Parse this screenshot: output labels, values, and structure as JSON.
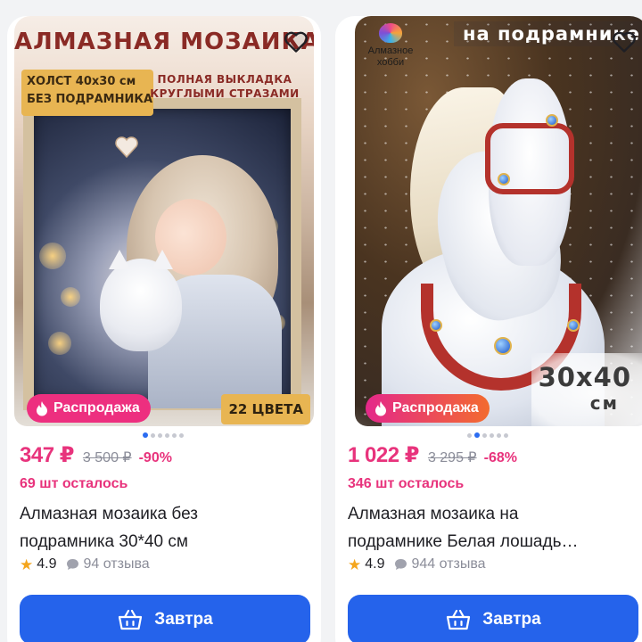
{
  "products": [
    {
      "photo": {
        "title": "АЛМАЗНАЯ МОЗАИКА",
        "badge_line1": "ХОЛСТ 40х30 см",
        "badge_line2": "БЕЗ ПОДРАМНИКА",
        "subtitle_line1": "ПОЛНАЯ ВЫКЛАДКА",
        "subtitle_line2": "КРУГЛЫМИ СТРАЗАМИ",
        "colors_tag": "22 ЦВЕТА"
      },
      "sale_label": "Распродажа",
      "price": "347 ₽",
      "old_price": "3 500 ₽",
      "discount": "-90%",
      "stock": "69 шт осталось",
      "name_line1": "Алмазная мозаика без",
      "name_line2": "подрамника 30*40 см",
      "rating": "4.9",
      "reviews": "94 отзыва",
      "button_label": "Завтра",
      "slides": {
        "total": 6,
        "active": 1
      }
    },
    {
      "photo": {
        "banner": "на подрамнике",
        "logo_line1": "Алмазное",
        "logo_line2": "хобби",
        "size_value": "30x40",
        "size_unit": "см"
      },
      "sale_label": "Распродажа",
      "price": "1 022 ₽",
      "old_price": "3 295 ₽",
      "discount": "-68%",
      "stock": "346 шт осталось",
      "name_line1": "Алмазная мозаика на",
      "name_line2": "подрамнике Белая лошадь…",
      "rating": "4.9",
      "reviews": "944 отзыва",
      "button_label": "Завтра",
      "slides": {
        "total": 6,
        "active": 2
      }
    }
  ],
  "icons": {
    "favorite": "heart-outline-icon",
    "sale": "flame-icon",
    "rating": "star-icon",
    "reviews": "speech-bubble-icon",
    "delivery": "basket-icon"
  },
  "colors": {
    "accent_pink": "#e8337c",
    "button_blue": "#2563eb",
    "star": "#f4a51c",
    "muted": "#8b8d99"
  }
}
